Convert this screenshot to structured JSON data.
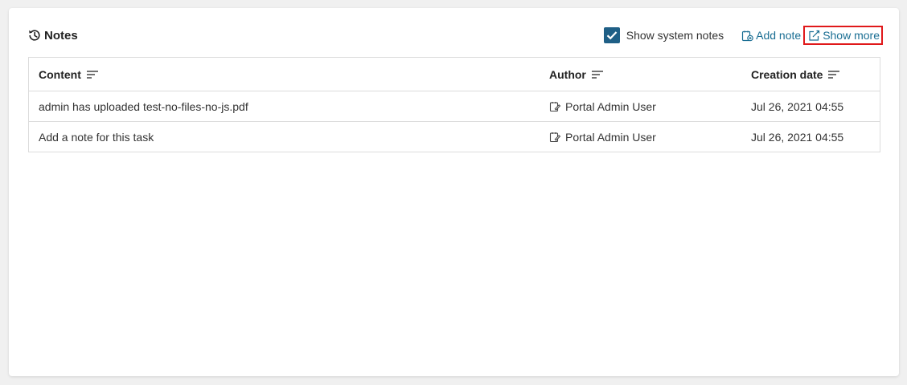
{
  "notes": {
    "title": "Notes",
    "show_system_notes_label": "Show system notes",
    "show_system_notes_checked": true,
    "add_note_label": "Add note",
    "show_more_label": "Show more",
    "columns": {
      "content": "Content",
      "author": "Author",
      "creation_date": "Creation date"
    },
    "rows": [
      {
        "content": "admin has uploaded test-no-files-no-js.pdf",
        "author": "Portal Admin User",
        "creation_date": "Jul 26, 2021 04:55"
      },
      {
        "content": "Add a note for this task",
        "author": "Portal Admin User",
        "creation_date": "Jul 26, 2021 04:55"
      }
    ]
  },
  "colors": {
    "accent": "#1a6e93",
    "checkbox": "#1f5f86",
    "highlight": "#e0181a"
  },
  "icons": {
    "title": "history-icon",
    "add_note": "add-note-icon",
    "show_more": "open-external-icon",
    "sort": "sort-icon",
    "author": "user-note-icon"
  }
}
